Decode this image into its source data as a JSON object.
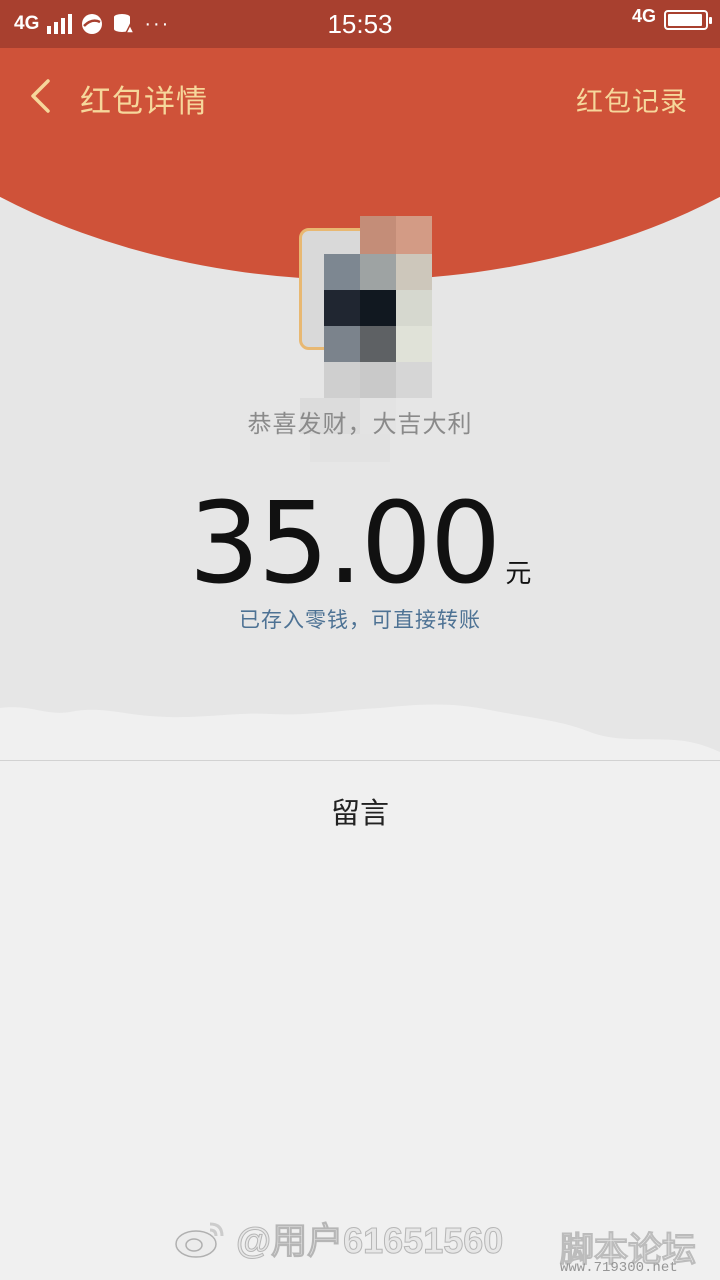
{
  "status_bar": {
    "network_left": "4G",
    "dots": "···",
    "time": "15:53",
    "network_right": "4G",
    "battery_level": 0.95
  },
  "navbar": {
    "title": "红包详情",
    "record_label": "红包记录",
    "back_icon": "chevron-left-icon"
  },
  "card": {
    "sender_line": "恭喜发财，大吉大利",
    "amount": "35.00",
    "unit": "元",
    "saved_note": "已存入零钱，可直接转账"
  },
  "message": {
    "label": "留言"
  },
  "watermark": {
    "weibo_user": "@用户61651560",
    "site_name": "脚本论坛",
    "site_url": "www.719300.net"
  },
  "colors": {
    "header_red": "#cf5239",
    "status_bar": "#a8402f",
    "gold_text": "#f6d79b",
    "link_blue": "#4d7294",
    "avatar_border": "#e8b872"
  }
}
